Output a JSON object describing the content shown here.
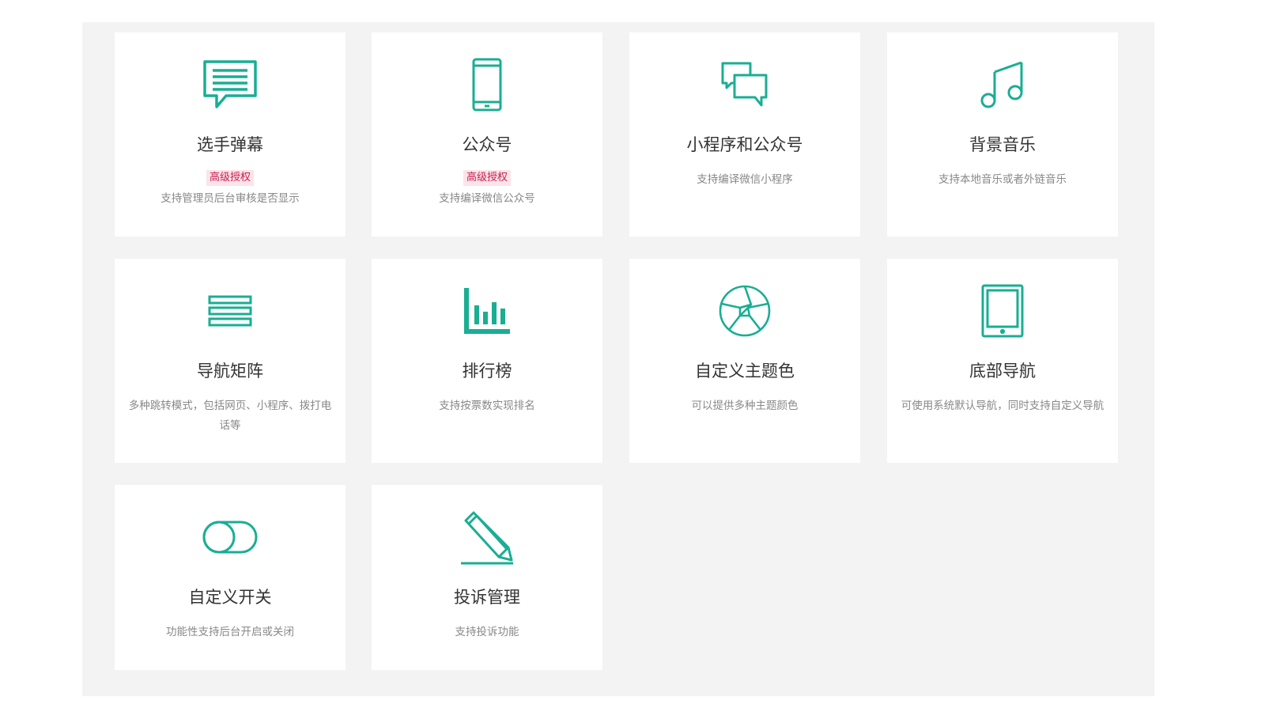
{
  "colors": {
    "accent": "#1aae93",
    "panel_bg": "#f3f3f3",
    "card_bg": "#ffffff",
    "badge_bg": "#fbe4ea",
    "badge_text": "#c81e4f"
  },
  "cards": [
    {
      "icon": "chat-bubble-icon",
      "title": "选手弹幕",
      "badge": "高级授权",
      "desc": "支持管理员后台审核是否显示"
    },
    {
      "icon": "mobile-phone-icon",
      "title": "公众号",
      "badge": "高级授权",
      "desc": "支持编译微信公众号"
    },
    {
      "icon": "conversation-icon",
      "title": "小程序和公众号",
      "desc": "支持编译微信小程序"
    },
    {
      "icon": "music-note-icon",
      "title": "背景音乐",
      "desc": "支持本地音乐或者外链音乐"
    },
    {
      "icon": "menu-lines-icon",
      "title": "导航矩阵",
      "desc": "多种跳转模式，包括网页、小程序、拨打电话等"
    },
    {
      "icon": "bar-chart-icon",
      "title": "排行榜",
      "desc": "支持按票数实现排名"
    },
    {
      "icon": "aperture-icon",
      "title": "自定义主题色",
      "desc": "可以提供多种主题颜色"
    },
    {
      "icon": "tablet-icon",
      "title": "底部导航",
      "desc": "可使用系统默认导航，同时支持自定义导航"
    },
    {
      "icon": "toggle-switch-icon",
      "title": "自定义开关",
      "desc": "功能性支持后台开启或关闭"
    },
    {
      "icon": "pencil-icon",
      "title": "投诉管理",
      "desc": "支持投诉功能"
    }
  ]
}
